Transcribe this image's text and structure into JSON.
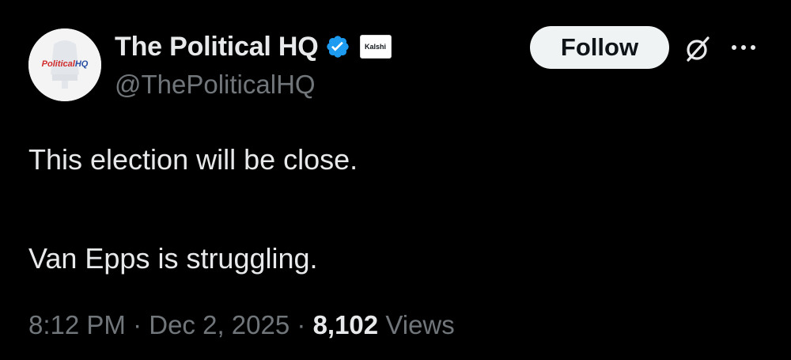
{
  "author": {
    "display_name": "The Political HQ",
    "handle": "@ThePoliticalHQ",
    "avatar_logo_text": "PoliticalHQ",
    "verified_icon": "verified-badge-icon",
    "affiliate_label": "Kalshi"
  },
  "actions": {
    "follow_label": "Follow",
    "grok_icon": "grok-icon",
    "more_icon": "more-options-icon"
  },
  "tweet": {
    "lines": [
      "This election will be close.",
      "Van Epps is struggling."
    ]
  },
  "meta": {
    "time": "8:12 PM",
    "separator": "·",
    "date": "Dec 2, 2025",
    "views_count": "8,102",
    "views_label": "Views"
  },
  "colors": {
    "background": "#000000",
    "primary_text": "#e7e9ea",
    "secondary_text": "#71767b",
    "verified_blue": "#1d9bf0",
    "follow_bg": "#eff3f4"
  }
}
